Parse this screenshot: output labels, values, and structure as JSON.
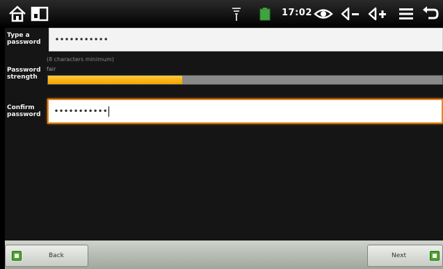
{
  "status_bar": {
    "time": "17:02"
  },
  "form": {
    "password_label_line1": "Type a",
    "password_label_line2": "password",
    "password_value": "•••••••••••",
    "hint": "(8 characters minimum)",
    "strength_label_line1": "Password",
    "strength_label_line2": "strength",
    "strength_value": "fair",
    "strength_fraction": 0.34,
    "confirm_label_line1": "Confirm",
    "confirm_label_line2": "password",
    "confirm_value": "•••••••••••"
  },
  "bottom_bar": {
    "back_label": "Back",
    "next_label": "Next"
  },
  "colors": {
    "meter_fill": "#f1a400",
    "focus_border": "#e8871c",
    "button_icon": "#4ca62c"
  },
  "icons": [
    "home-icon",
    "recent-apps-icon",
    "wifi-signal-icon",
    "battery-icon",
    "eye-icon",
    "volume-down-icon",
    "volume-up-icon",
    "menu-icon",
    "back-icon"
  ]
}
